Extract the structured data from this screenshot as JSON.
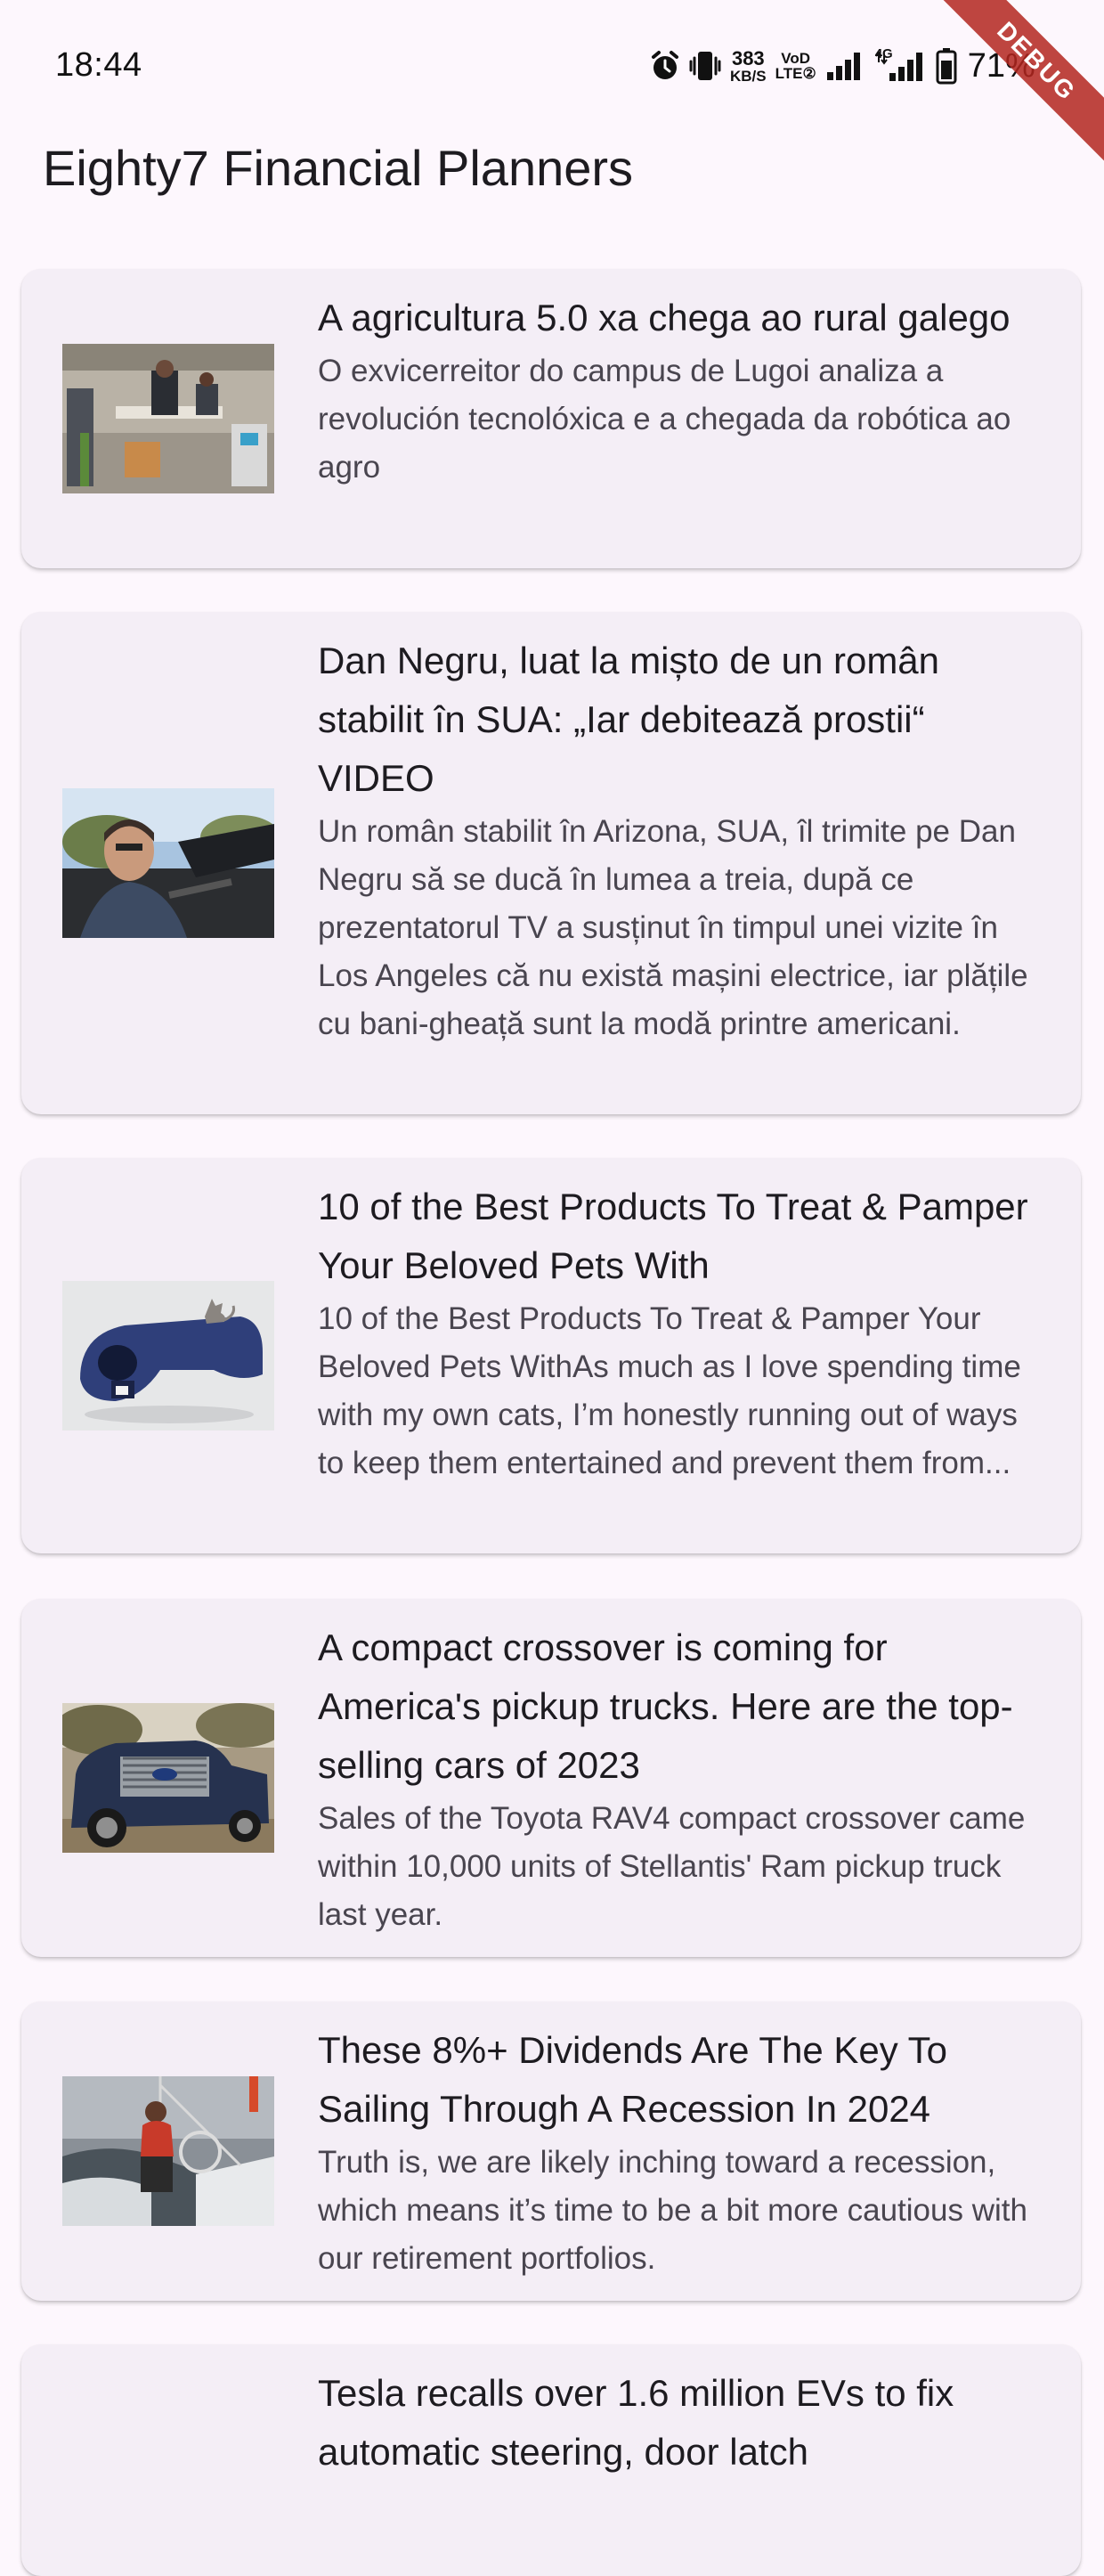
{
  "status_bar": {
    "time": "18:44",
    "net_speed_top": "383",
    "net_speed_unit": "KB/S",
    "volte_top": "VoD",
    "volte_bottom": "LTE②",
    "network_type": "4G",
    "battery_percent": "71%",
    "icons": [
      "alarm-icon",
      "vibrate-icon",
      "signal-icon",
      "signal-4g-icon",
      "battery-icon"
    ]
  },
  "debug_banner": "DEBUG",
  "app_bar": {
    "title": "Eighty7 Financial Planners"
  },
  "articles": [
    {
      "title": "A agricultura 5.0 xa chega ao rural galego",
      "description": "O exvicerreitor do campus de Lugoi analiza a revolución tecnolóxica e a chegada da robótica ao agro",
      "thumbnail": "lab-robotics-photo"
    },
    {
      "title": "Dan Negru, luat la mișto de un român stabilit în SUA: „Iar debitează prostii“ VIDEO",
      "description": "Un român stabilit în Arizona, SUA, îl trimite pe Dan Negru să se ducă în lumea a treia, după ce prezentatorul TV a susținut în timpul unei vizite în Los Angeles că nu există mașini electrice, iar plățile cu bani-gheață sunt la modă printre americani.",
      "thumbnail": "man-driving-convertible-photo"
    },
    {
      "title": "10 of the Best Products To Treat & Pamper Your Beloved Pets With",
      "description": "10 of the Best Products To Treat & Pamper Your Beloved Pets WithAs much as I love spending time with my own cats, I’m honestly running out of ways to keep them entertained and prevent them from...",
      "thumbnail": "cat-tunnel-photo"
    },
    {
      "title": "A compact crossover is coming for America's pickup trucks. Here are the top-selling cars of 2023",
      "description": "Sales of the Toyota RAV4 compact crossover came within 10,000 units of Stellantis' Ram pickup truck last year.",
      "thumbnail": "pickup-truck-photo"
    },
    {
      "title": "These 8%+ Dividends Are The Key To Sailing Through A Recession In 2024",
      "description": "Truth is, we are likely inching toward a recession, which means it’s time to be a bit more cautious with our retirement portfolios.",
      "thumbnail": "sailing-photo"
    },
    {
      "title": "Tesla recalls over 1.6 million EVs to fix automatic steering, door latch",
      "description": "",
      "thumbnail": ""
    }
  ]
}
